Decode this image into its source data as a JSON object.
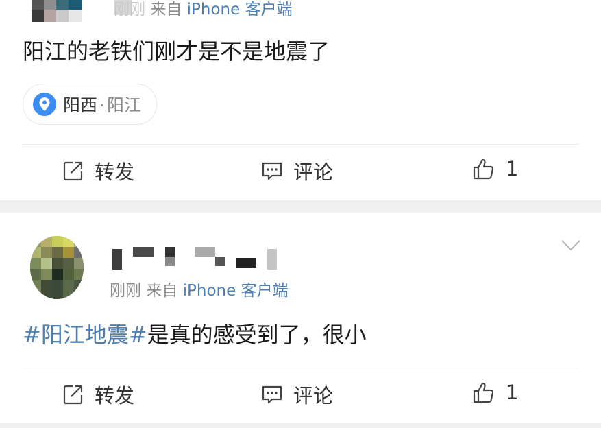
{
  "posts": [
    {
      "time": "刚刚",
      "source_prefix": "来自",
      "source": "iPhone 客户端",
      "text": "阳江的老铁们刚才是不是地震了",
      "location": {
        "district": "阳西",
        "separator": "·",
        "city": "阳江"
      },
      "actions": {
        "repost": "转发",
        "comment": "评论",
        "like_count": "1"
      }
    },
    {
      "time": "刚刚",
      "source_prefix": "来自",
      "source": "iPhone 客户端",
      "text": {
        "hashtag": "#阳江地震#",
        "body": "是真的感受到了，很小"
      },
      "actions": {
        "repost": "转发",
        "comment": "评论",
        "like_count": "1"
      }
    }
  ],
  "icons": {
    "repost": "edit-share-icon",
    "comment": "comment-bubble-icon",
    "like": "thumbs-up-icon",
    "location": "location-pin-icon",
    "menu": "chevron-down-icon"
  },
  "colors": {
    "link_blue": "#4e7fb3",
    "location_pin": "#3b8cf1",
    "text": "#1a1a1a",
    "separator": "#efefef"
  }
}
